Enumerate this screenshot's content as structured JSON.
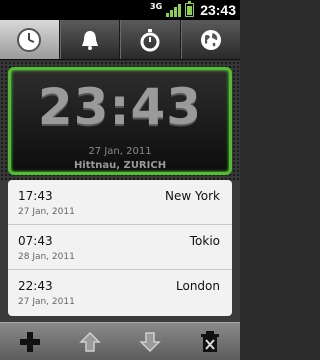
{
  "status": {
    "network": "3G",
    "time": "23:43"
  },
  "tabs": [
    {
      "name": "clock",
      "icon": "clock-icon",
      "active": true
    },
    {
      "name": "alarm",
      "icon": "bell-icon",
      "active": false
    },
    {
      "name": "stopwatch",
      "icon": "stopwatch-icon",
      "active": false
    },
    {
      "name": "world",
      "icon": "globe-icon",
      "active": false
    }
  ],
  "clock": {
    "time": "23:43",
    "date": "27 Jan, 2011",
    "location": "Hittnau, ZURICH"
  },
  "cities": [
    {
      "time": "17:43",
      "date": "27 Jan, 2011",
      "city": "New York"
    },
    {
      "time": "07:43",
      "date": "28 Jan, 2011",
      "city": "Tokio"
    },
    {
      "time": "22:43",
      "date": "27 Jan, 2011",
      "city": "London"
    }
  ],
  "toolbar": [
    {
      "icon": "plus-icon"
    },
    {
      "icon": "arrow-up-icon"
    },
    {
      "icon": "arrow-down-icon"
    },
    {
      "icon": "trash-icon"
    }
  ],
  "colors": {
    "accent_green": "#4fbf2e",
    "signal": "#8fd14f"
  }
}
